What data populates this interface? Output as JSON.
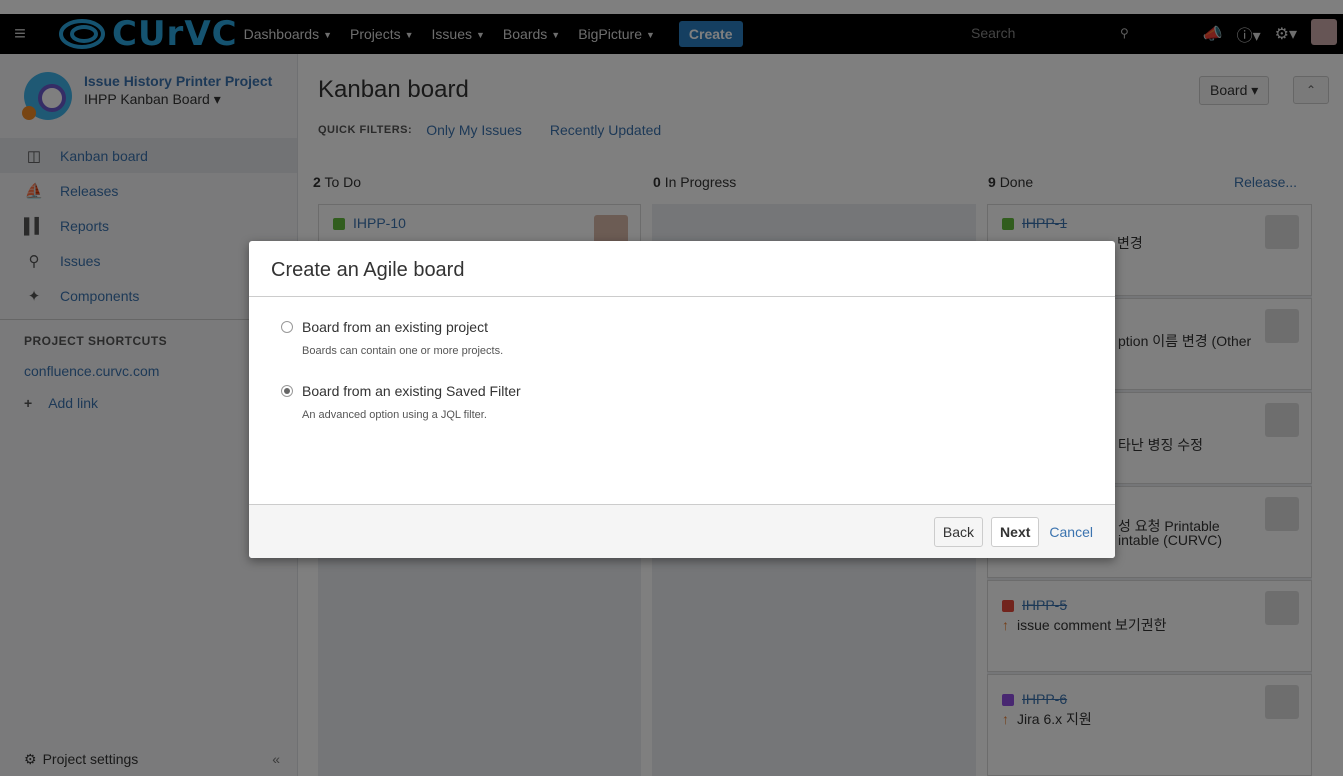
{
  "nav": {
    "logo_text": "CUrVC",
    "items": [
      {
        "label": "Dashboards"
      },
      {
        "label": "Projects"
      },
      {
        "label": "Issues"
      },
      {
        "label": "Boards"
      },
      {
        "label": "BigPicture"
      }
    ],
    "create_label": "Create",
    "search_placeholder": "Search",
    "icons": [
      "menu-icon",
      "search-icon",
      "megaphone-icon",
      "help-icon",
      "gear-icon"
    ]
  },
  "sidebar": {
    "project_name": "Issue History Printer Project",
    "board_name": "IHPP Kanban Board",
    "items": [
      {
        "label": "Kanban board",
        "icon": "board-icon",
        "active": true
      },
      {
        "label": "Releases",
        "icon": "ship-icon"
      },
      {
        "label": "Reports",
        "icon": "reports-icon"
      },
      {
        "label": "Issues",
        "icon": "issues-icon"
      },
      {
        "label": "Components",
        "icon": "puzzle-icon"
      }
    ],
    "shortcuts_title": "PROJECT SHORTCUTS",
    "shortcut": "confluence.curvc.com",
    "add_link": "Add link",
    "settings": "Project settings",
    "collapse": "«"
  },
  "main": {
    "title": "Kanban board",
    "quick_filters_label": "QUICK FILTERS:",
    "filters": [
      "Only My Issues",
      "Recently Updated"
    ],
    "board_button": "Board",
    "columns": [
      {
        "count": "2",
        "name": "To Do"
      },
      {
        "count": "0",
        "name": "In Progress"
      },
      {
        "count": "9",
        "name": "Done"
      }
    ],
    "release_link": "Release...",
    "todo_card": {
      "key": "IHPP-10"
    },
    "done_cards": [
      {
        "key": "IHPP-1",
        "summary": "변경"
      },
      {
        "key": "",
        "summary": "ption 이름 변경 (Other"
      },
      {
        "key": "",
        "summary": "타난 병징 수정"
      },
      {
        "key": "",
        "summary": "성 요청 Printable\nintable (CURVC)"
      },
      {
        "key": "IHPP-5",
        "summary": "issue comment 보기권한"
      },
      {
        "key": "IHPP-6",
        "summary": "Jira 6.x 지원"
      }
    ]
  },
  "dialog": {
    "title": "Create an Agile board",
    "options": [
      {
        "label": "Board from an existing project",
        "desc": "Boards can contain one or more projects.",
        "checked": false
      },
      {
        "label": "Board from an existing Saved Filter",
        "desc": "An advanced option using a JQL filter.",
        "checked": true
      }
    ],
    "back": "Back",
    "next": "Next",
    "cancel": "Cancel"
  }
}
